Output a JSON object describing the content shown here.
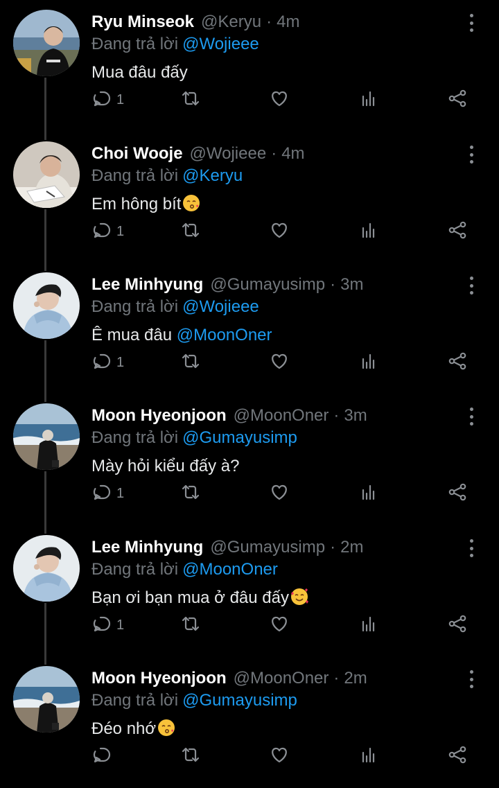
{
  "tweets": [
    {
      "name": "Ryu Minseok",
      "handle": "@Keryu",
      "time": "4m",
      "replying_label": "Đang trả lời",
      "reply_to": "@Wojieee",
      "text": "Mua đâu đấy",
      "text_mention": "",
      "emoji": "",
      "reply_count": "1",
      "avatar": "avatar-seaside"
    },
    {
      "name": "Choi Wooje",
      "handle": "@Wojieee",
      "time": "4m",
      "replying_label": "Đang trả lời",
      "reply_to": "@Keryu",
      "text": "Em hông bít",
      "text_mention": "",
      "emoji": "kissing-face",
      "reply_count": "1",
      "avatar": "avatar-drawing"
    },
    {
      "name": "Lee Minhyung",
      "handle": "@Gumayusimp",
      "time": "3m",
      "replying_label": "Đang trả lời",
      "reply_to": "@Wojieee",
      "text": "Ê mua đâu ",
      "text_mention": "@MoonOner",
      "emoji": "",
      "reply_count": "1",
      "avatar": "avatar-hoodie"
    },
    {
      "name": "Moon Hyeonjoon",
      "handle": "@MoonOner",
      "time": "3m",
      "replying_label": "Đang trả lời",
      "reply_to": "@Gumayusimp",
      "text": "Mày hỏi kiểu đấy à?",
      "text_mention": "",
      "emoji": "",
      "reply_count": "1",
      "avatar": "avatar-beach"
    },
    {
      "name": "Lee Minhyung",
      "handle": "@Gumayusimp",
      "time": "2m",
      "replying_label": "Đang trả lời",
      "reply_to": "@MoonOner",
      "text": "Bạn ơi bạn mua ở đâu đấy",
      "text_mention": "",
      "emoji": "smiling-face-with-hearts",
      "reply_count": "1",
      "avatar": "avatar-hoodie"
    },
    {
      "name": "Moon Hyeonjoon",
      "handle": "@MoonOner",
      "time": "2m",
      "replying_label": "Đang trả lời",
      "reply_to": "@Gumayusimp",
      "text": "Đéo nhớ",
      "text_mention": "",
      "emoji": "kissing-face",
      "reply_count": "",
      "avatar": "avatar-beach"
    }
  ],
  "icons": {
    "reply": "reply-icon",
    "retweet": "retweet-icon",
    "like": "heart-icon",
    "stats": "stats-icon",
    "share": "share-icon",
    "more": "more-vertical-icon"
  },
  "colors": {
    "background": "#000000",
    "text": "#e7e9ea",
    "muted": "#71767b",
    "link": "#1d9bf0",
    "thread_line": "#3a3a3a"
  }
}
